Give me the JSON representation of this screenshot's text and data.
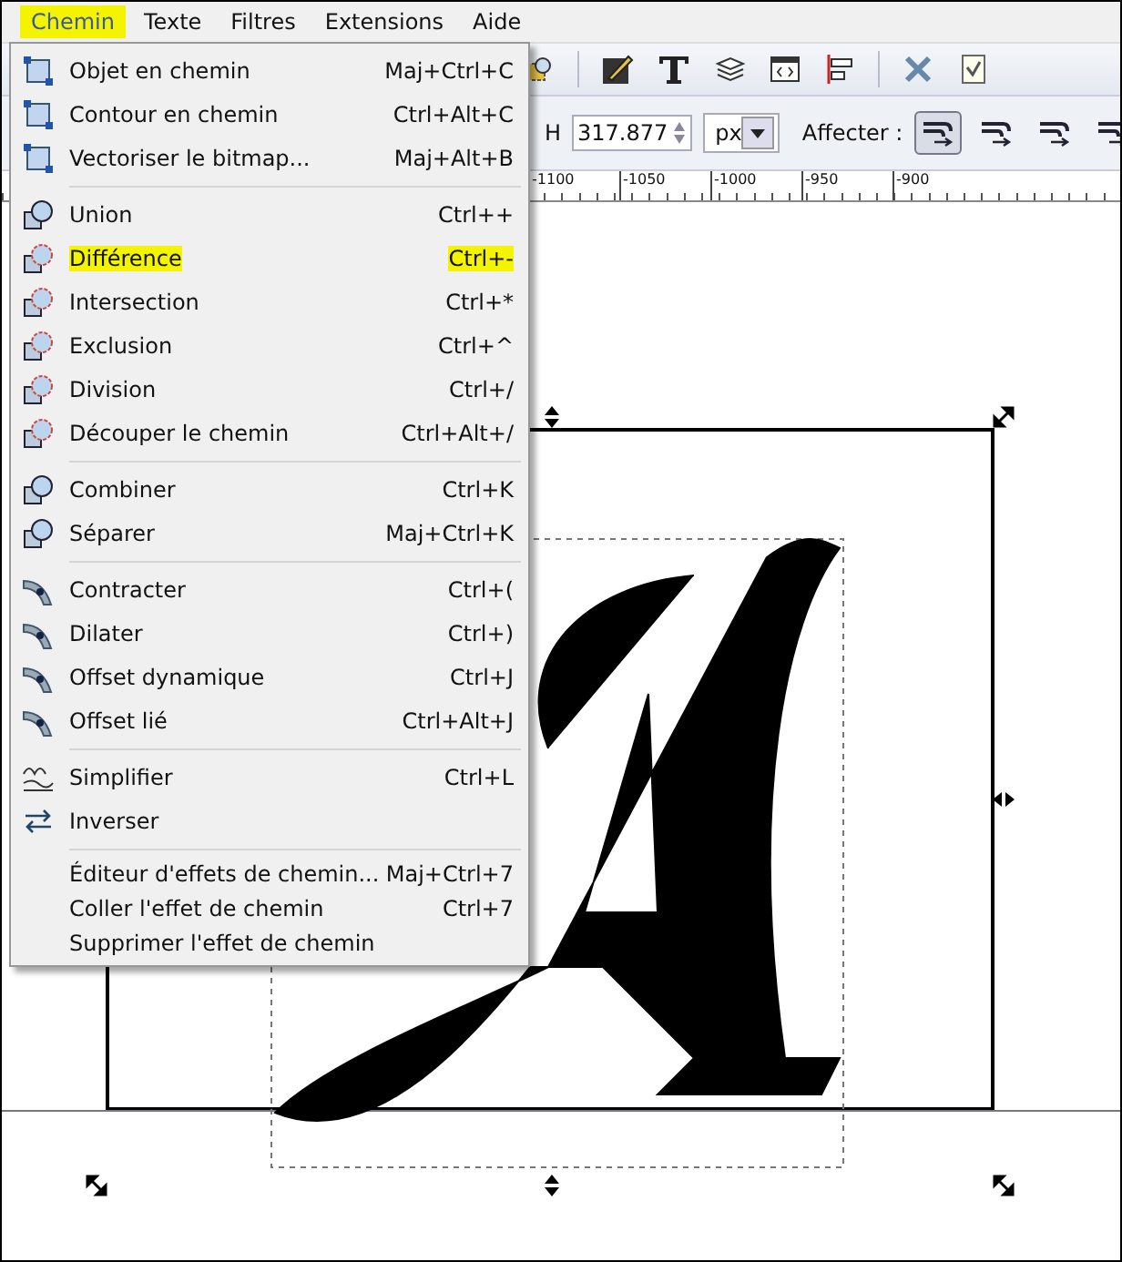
{
  "menubar": [
    {
      "label": "Chemin",
      "highlighted": true,
      "open": true
    },
    {
      "label": "Texte",
      "highlighted": false,
      "open": false
    },
    {
      "label": "Filtres",
      "highlighted": false,
      "open": false
    },
    {
      "label": "Extensions",
      "highlighted": false,
      "open": false
    },
    {
      "label": "Aide",
      "highlighted": false,
      "open": false
    }
  ],
  "toolbar": {
    "h_label": "H",
    "h_value": "317.877",
    "unit": "px",
    "affect_label": "Affecter :",
    "affect_toggles": [
      {
        "pressed": true
      },
      {
        "pressed": false
      },
      {
        "pressed": false
      },
      {
        "pressed": false
      }
    ]
  },
  "ruler": [
    "-1100",
    "-1050",
    "-1000",
    "-950",
    "-900"
  ],
  "menu": {
    "groups": [
      [
        {
          "label": "Objet en chemin",
          "shortcut": "Maj+Ctrl+C",
          "highlighted": false
        },
        {
          "label": "Contour en chemin",
          "shortcut": "Ctrl+Alt+C",
          "highlighted": false
        },
        {
          "label": "Vectoriser le bitmap...",
          "shortcut": "Maj+Alt+B",
          "highlighted": false
        }
      ],
      [
        {
          "label": "Union",
          "shortcut": "Ctrl++",
          "highlighted": false
        },
        {
          "label": "Différence",
          "shortcut": "Ctrl+-",
          "highlighted": true
        },
        {
          "label": "Intersection",
          "shortcut": "Ctrl+*",
          "highlighted": false
        },
        {
          "label": "Exclusion",
          "shortcut": "Ctrl+^",
          "highlighted": false
        },
        {
          "label": "Division",
          "shortcut": "Ctrl+/",
          "highlighted": false
        },
        {
          "label": "Découper le chemin",
          "shortcut": "Ctrl+Alt+/",
          "highlighted": false
        }
      ],
      [
        {
          "label": "Combiner",
          "shortcut": "Ctrl+K",
          "highlighted": false
        },
        {
          "label": "Séparer",
          "shortcut": "Maj+Ctrl+K",
          "highlighted": false
        }
      ],
      [
        {
          "label": "Contracter",
          "shortcut": "Ctrl+(",
          "highlighted": false
        },
        {
          "label": "Dilater",
          "shortcut": "Ctrl+)",
          "highlighted": false
        },
        {
          "label": "Offset dynamique",
          "shortcut": "Ctrl+J",
          "highlighted": false
        },
        {
          "label": "Offset lié",
          "shortcut": "Ctrl+Alt+J",
          "highlighted": false
        }
      ],
      [
        {
          "label": "Simplifier",
          "shortcut": "Ctrl+L",
          "highlighted": false
        },
        {
          "label": "Inverser",
          "highlighted": false
        }
      ],
      [
        {
          "label": "Éditeur d'effets de chemin...",
          "shortcut": "Maj+Ctrl+7",
          "highlighted": false,
          "kind": "plain"
        },
        {
          "label": "Coller l'effet de chemin",
          "shortcut": "Ctrl+7",
          "highlighted": false,
          "kind": "plain"
        },
        {
          "label": "Supprimer l'effet de chemin",
          "highlighted": false,
          "kind": "plain"
        }
      ]
    ]
  }
}
